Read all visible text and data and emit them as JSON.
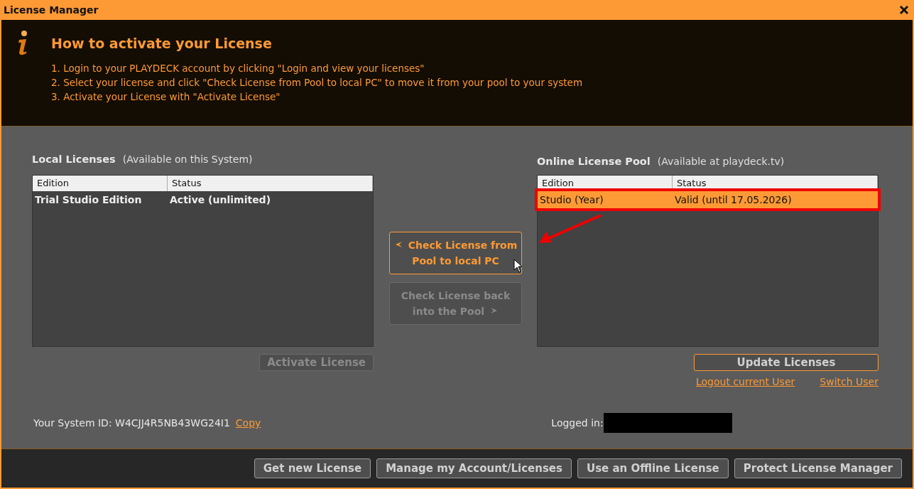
{
  "window": {
    "title": "License Manager"
  },
  "info": {
    "title": "How to activate your License",
    "steps": [
      "1. Login to your PLAYDECK account by clicking \"Login and view your licenses\"",
      "2. Select your license and click \"Check License from Pool to local PC\" to move it from your pool to your system",
      "3. Activate your License with \"Activate License\""
    ]
  },
  "local": {
    "title": "Local Licenses",
    "subtitle": "(Available on this System)",
    "columns": [
      "Edition",
      "Status"
    ],
    "rows": [
      {
        "cells": [
          "Trial Studio Edition",
          "Active (unlimited)"
        ],
        "selected": false,
        "highlighted": false
      }
    ],
    "button": {
      "label": "Activate License",
      "disabled": true,
      "focused": false
    }
  },
  "transfer": [
    {
      "label": "Check License from Pool to local PC",
      "kind": "fetch",
      "disabled": false,
      "focused": true
    },
    {
      "label": "Check License back into the Pool",
      "kind": "return",
      "disabled": true,
      "focused": false
    }
  ],
  "online": {
    "title": "Online License Pool",
    "subtitle": "(Available at playdeck.tv)",
    "columns": [
      "Edition",
      "Status"
    ],
    "rows": [
      {
        "cells": [
          "Studio (Year)",
          "Valid (until 17.05.2026)"
        ],
        "selected": true,
        "highlighted": true
      }
    ],
    "button": {
      "label": "Update Licenses",
      "disabled": false,
      "focused": true
    },
    "links": [
      "Logout current User",
      "Switch User"
    ]
  },
  "system_id": {
    "label": "Your System ID: W4CJJ4R5NB43WG24I1",
    "link": "Copy"
  },
  "logged_in": {
    "label": "Logged in:"
  },
  "footer_buttons": [
    "Get new License",
    "Manage my Account/Licenses",
    "Use an Offline License",
    "Protect License Manager"
  ]
}
